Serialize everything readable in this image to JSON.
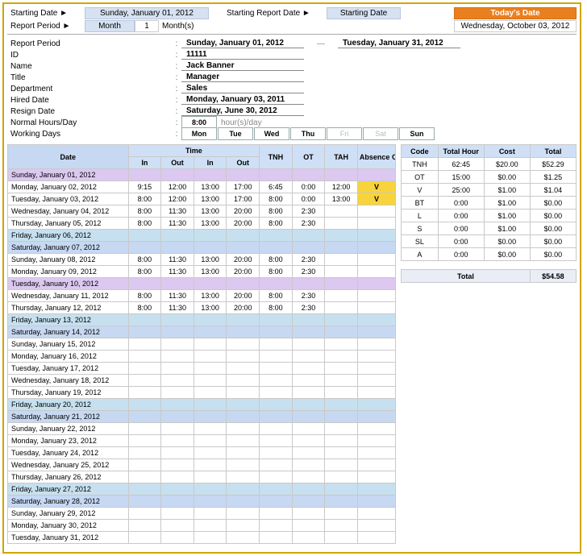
{
  "header": {
    "starting_date_label": "Starting Date ►",
    "starting_date_value": "Sunday, January 01, 2012",
    "starting_report_label": "Starting Report Date ►",
    "starting_report_value": "Starting Date",
    "todays_date_label": "Today's Date",
    "report_period_label": "Report Period ►",
    "report_period_type": "Month",
    "report_period_count": "1",
    "report_period_unit": "Month(s)",
    "today_value": "Wednesday, October 03, 2012"
  },
  "details": {
    "report_period_label": "Report Period",
    "period_from": "Sunday, January 01, 2012",
    "period_to": "Tuesday, January 31, 2012",
    "period_dash": "—",
    "id_label": "ID",
    "id_value": "11111",
    "name_label": "Name",
    "name_value": "Jack Banner",
    "title_label": "Title",
    "title_value": "Manager",
    "department_label": "Department",
    "department_value": "Sales",
    "hired_label": "Hired Date",
    "hired_value": "Monday, January 03, 2011",
    "resign_label": "Resign Date",
    "resign_value": "Saturday, June 30, 2012",
    "normal_label": "Normal Hours/Day",
    "normal_hours": "8:00",
    "normal_unit": "hour(s)/day",
    "workdays_label": "Working Days",
    "days": [
      "Mon",
      "Tue",
      "Wed",
      "Thu",
      "Fri",
      "Sat",
      "Sun"
    ],
    "days_muted": [
      false,
      false,
      false,
      false,
      true,
      true,
      false
    ]
  },
  "timesheet": {
    "head": {
      "date": "Date",
      "time": "Time",
      "in": "In",
      "out": "Out",
      "tnh": "TNH",
      "ot": "OT",
      "tah": "TAH",
      "absence": "Absence Code"
    },
    "rows": [
      {
        "date": "Sunday, January 01, 2012",
        "cls": "special",
        "in1": "",
        "out1": "",
        "in2": "",
        "out2": "",
        "tnh": "",
        "ot": "",
        "tah": "",
        "abs": ""
      },
      {
        "date": "Monday, January 02, 2012",
        "cls": "",
        "in1": "9:15",
        "out1": "12:00",
        "in2": "13:00",
        "out2": "17:00",
        "tnh": "6:45",
        "ot": "0:00",
        "tah": "12:00",
        "abs": "V",
        "absYellow": true
      },
      {
        "date": "Tuesday, January 03, 2012",
        "cls": "",
        "in1": "8:00",
        "out1": "12:00",
        "in2": "13:00",
        "out2": "17:00",
        "tnh": "8:00",
        "ot": "0:00",
        "tah": "13:00",
        "abs": "V",
        "absYellow": true
      },
      {
        "date": "Wednesday, January 04, 2012",
        "cls": "",
        "in1": "8:00",
        "out1": "11:30",
        "in2": "13:00",
        "out2": "20:00",
        "tnh": "8:00",
        "ot": "2:30",
        "tah": "",
        "abs": ""
      },
      {
        "date": "Thursday, January 05, 2012",
        "cls": "",
        "in1": "8:00",
        "out1": "11:30",
        "in2": "13:00",
        "out2": "20:00",
        "tnh": "8:00",
        "ot": "2:30",
        "tah": "",
        "abs": ""
      },
      {
        "date": "Friday, January 06, 2012",
        "cls": "weekend-fri",
        "in1": "",
        "out1": "",
        "in2": "",
        "out2": "",
        "tnh": "",
        "ot": "",
        "tah": "",
        "abs": ""
      },
      {
        "date": "Saturday, January 07, 2012",
        "cls": "weekend-sat",
        "in1": "",
        "out1": "",
        "in2": "",
        "out2": "",
        "tnh": "",
        "ot": "",
        "tah": "",
        "abs": ""
      },
      {
        "date": "Sunday, January 08, 2012",
        "cls": "",
        "in1": "8:00",
        "out1": "11:30",
        "in2": "13:00",
        "out2": "20:00",
        "tnh": "8:00",
        "ot": "2:30",
        "tah": "",
        "abs": ""
      },
      {
        "date": "Monday, January 09, 2012",
        "cls": "",
        "in1": "8:00",
        "out1": "11:30",
        "in2": "13:00",
        "out2": "20:00",
        "tnh": "8:00",
        "ot": "2:30",
        "tah": "",
        "abs": ""
      },
      {
        "date": "Tuesday, January 10, 2012",
        "cls": "special",
        "in1": "",
        "out1": "",
        "in2": "",
        "out2": "",
        "tnh": "",
        "ot": "",
        "tah": "",
        "abs": ""
      },
      {
        "date": "Wednesday, January 11, 2012",
        "cls": "",
        "in1": "8:00",
        "out1": "11:30",
        "in2": "13:00",
        "out2": "20:00",
        "tnh": "8:00",
        "ot": "2:30",
        "tah": "",
        "abs": ""
      },
      {
        "date": "Thursday, January 12, 2012",
        "cls": "",
        "in1": "8:00",
        "out1": "11:30",
        "in2": "13:00",
        "out2": "20:00",
        "tnh": "8:00",
        "ot": "2:30",
        "tah": "",
        "abs": ""
      },
      {
        "date": "Friday, January 13, 2012",
        "cls": "weekend-fri"
      },
      {
        "date": "Saturday, January 14, 2012",
        "cls": "weekend-sat"
      },
      {
        "date": "Sunday, January 15, 2012",
        "cls": ""
      },
      {
        "date": "Monday, January 16, 2012",
        "cls": ""
      },
      {
        "date": "Tuesday, January 17, 2012",
        "cls": ""
      },
      {
        "date": "Wednesday, January 18, 2012",
        "cls": ""
      },
      {
        "date": "Thursday, January 19, 2012",
        "cls": ""
      },
      {
        "date": "Friday, January 20, 2012",
        "cls": "weekend-fri"
      },
      {
        "date": "Saturday, January 21, 2012",
        "cls": "weekend-sat"
      },
      {
        "date": "Sunday, January 22, 2012",
        "cls": ""
      },
      {
        "date": "Monday, January 23, 2012",
        "cls": ""
      },
      {
        "date": "Tuesday, January 24, 2012",
        "cls": ""
      },
      {
        "date": "Wednesday, January 25, 2012",
        "cls": ""
      },
      {
        "date": "Thursday, January 26, 2012",
        "cls": ""
      },
      {
        "date": "Friday, January 27, 2012",
        "cls": "weekend-fri"
      },
      {
        "date": "Saturday, January 28, 2012",
        "cls": "weekend-sat"
      },
      {
        "date": "Sunday, January 29, 2012",
        "cls": ""
      },
      {
        "date": "Monday, January 30, 2012",
        "cls": ""
      },
      {
        "date": "Tuesday, January 31, 2012",
        "cls": ""
      }
    ]
  },
  "summary": {
    "head": {
      "code": "Code",
      "hour": "Total Hour",
      "cost": "Cost",
      "total": "Total"
    },
    "rows": [
      {
        "code": "TNH",
        "hour": "62:45",
        "cost": "$20.00",
        "total": "$52.29"
      },
      {
        "code": "OT",
        "hour": "15:00",
        "cost": "$0.00",
        "total": "$1.25"
      },
      {
        "code": "V",
        "hour": "25:00",
        "cost": "$1.00",
        "total": "$1.04"
      },
      {
        "code": "BT",
        "hour": "0:00",
        "cost": "$1.00",
        "total": "$0.00"
      },
      {
        "code": "L",
        "hour": "0:00",
        "cost": "$1.00",
        "total": "$0.00"
      },
      {
        "code": "S",
        "hour": "0:00",
        "cost": "$1.00",
        "total": "$0.00"
      },
      {
        "code": "SL",
        "hour": "0:00",
        "cost": "$0.00",
        "total": "$0.00"
      },
      {
        "code": "A",
        "hour": "0:00",
        "cost": "$0.00",
        "total": "$0.00"
      }
    ],
    "total_label": "Total",
    "total_value": "$54.58"
  }
}
